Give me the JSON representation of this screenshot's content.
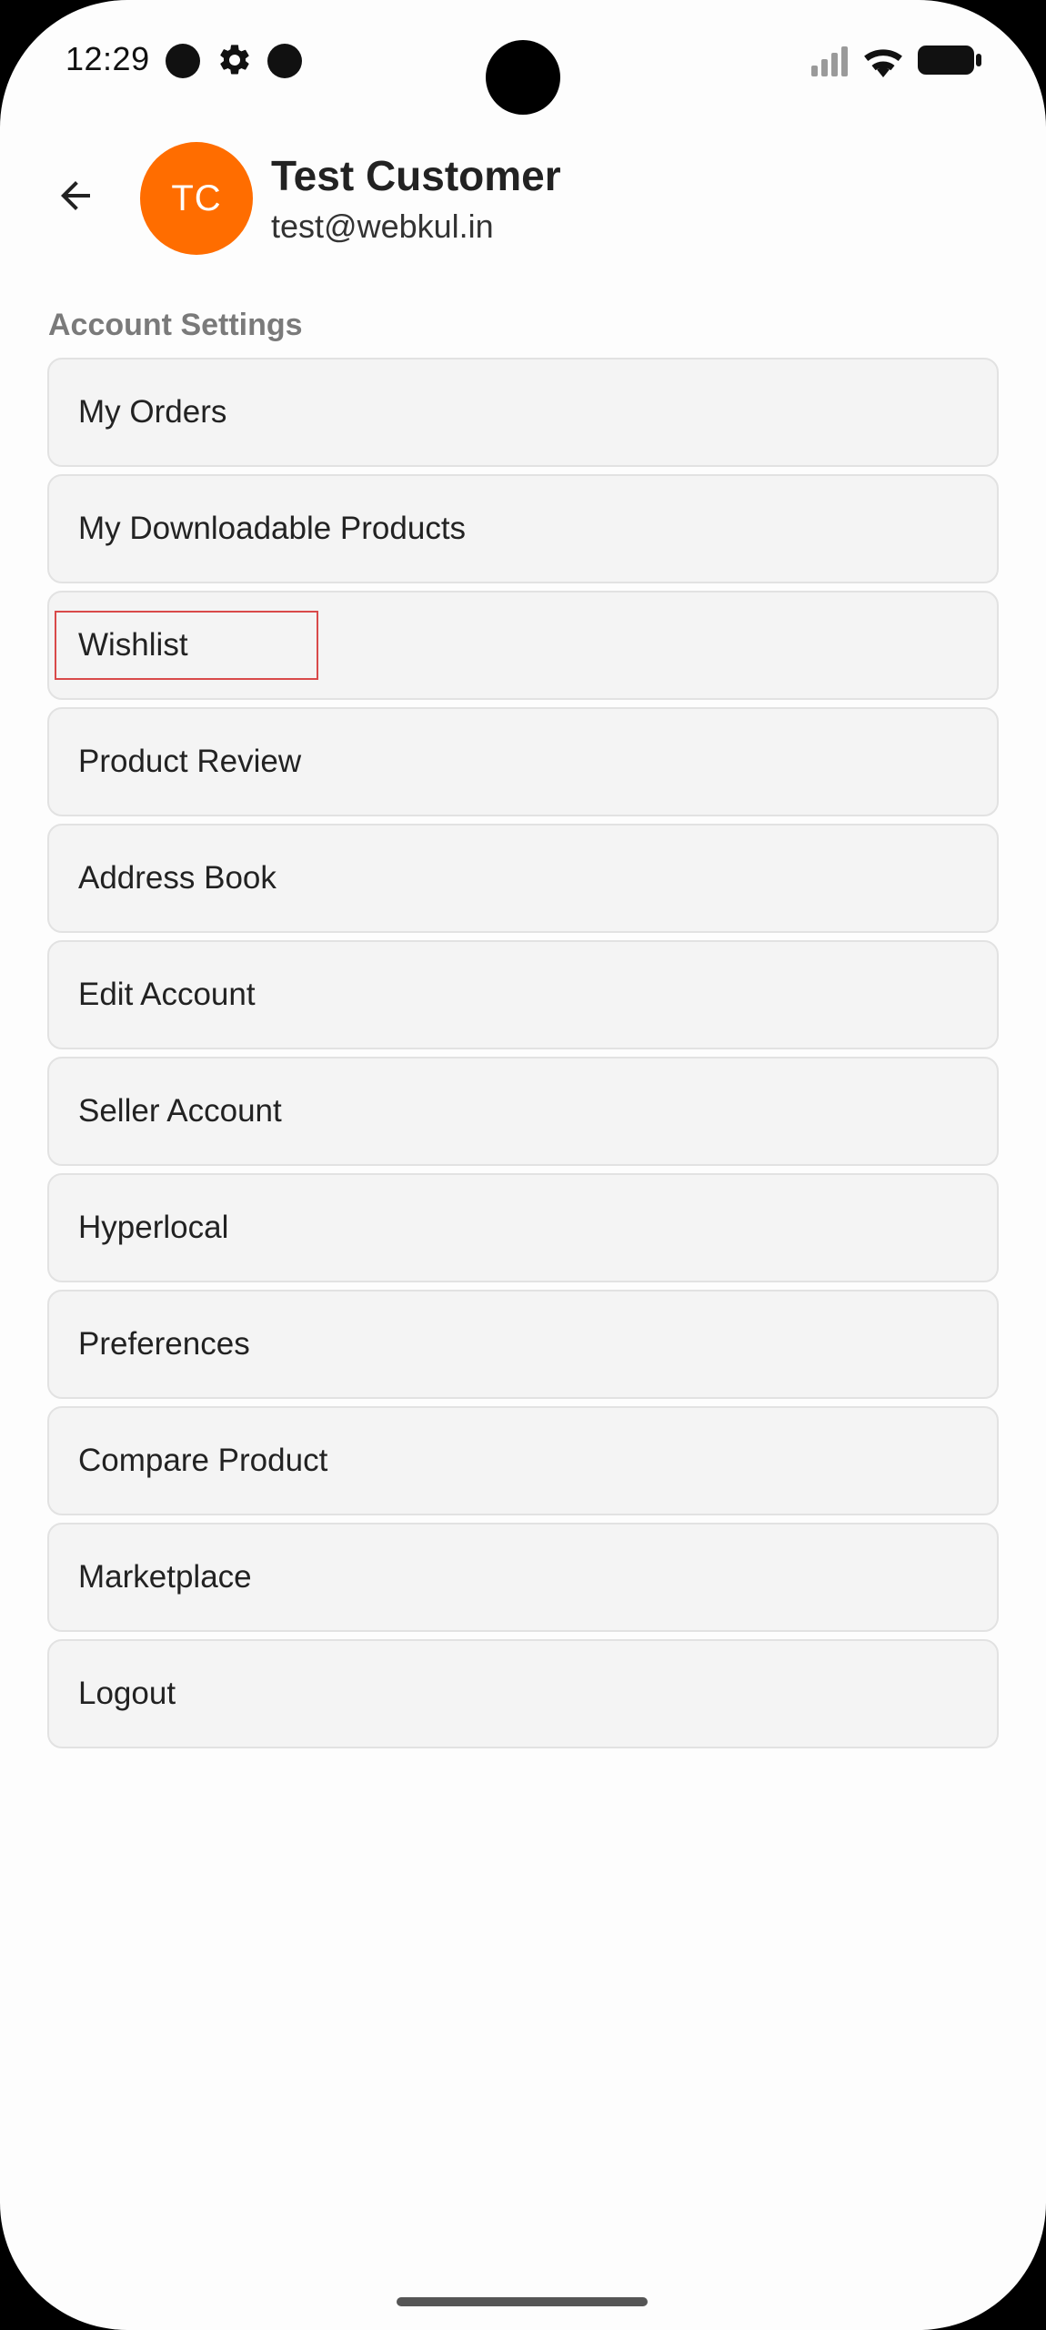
{
  "status_bar": {
    "time": "12:29",
    "icons": [
      "notification-dot-icon",
      "settings-gear-icon",
      "notification-dot-icon",
      "cell-signal-icon",
      "wifi-icon",
      "battery-icon"
    ]
  },
  "header": {
    "back_icon": "arrow-left-icon",
    "avatar_initials": "TC",
    "avatar_color": "#ff6d00",
    "name": "Test Customer",
    "email": "test@webkul.in"
  },
  "section": {
    "title": "Account Settings"
  },
  "menu": {
    "items": [
      {
        "label": "My Orders"
      },
      {
        "label": "My Downloadable Products"
      },
      {
        "label": "Wishlist",
        "highlighted": true
      },
      {
        "label": "Product Review"
      },
      {
        "label": "Address Book"
      },
      {
        "label": "Edit Account"
      },
      {
        "label": "Seller Account"
      },
      {
        "label": "Hyperlocal"
      },
      {
        "label": "Preferences"
      },
      {
        "label": "Compare Product"
      },
      {
        "label": "Marketplace"
      },
      {
        "label": "Logout"
      }
    ]
  }
}
